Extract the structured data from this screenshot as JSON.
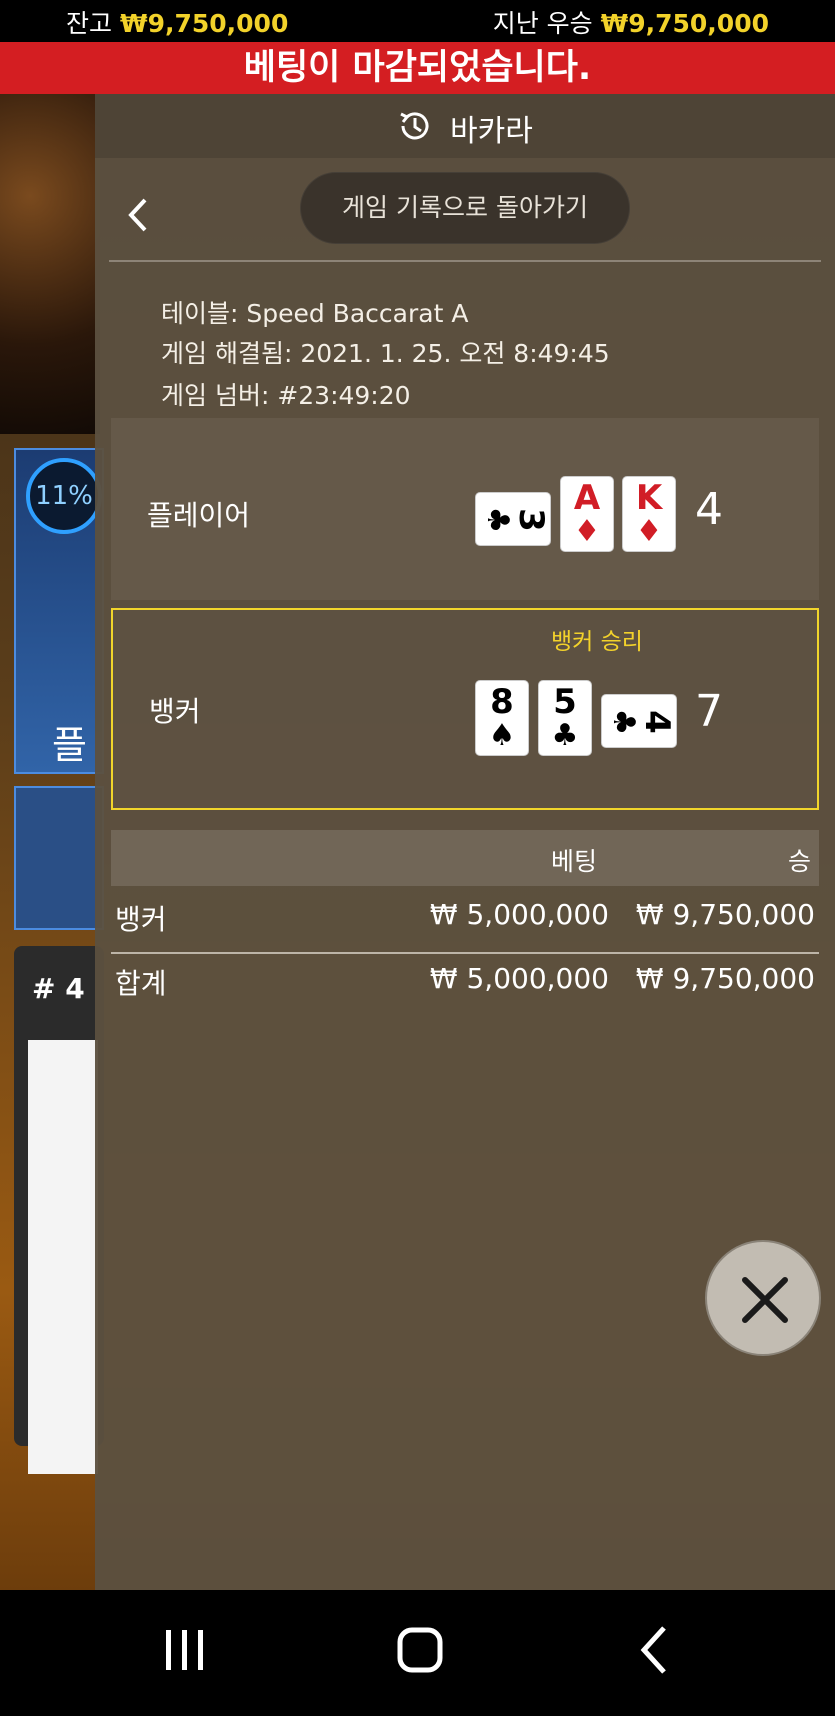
{
  "topbar": {
    "balance_label": "잔고",
    "balance_value": "₩9,750,000",
    "last_win_label": "지난 우승",
    "last_win_value": "₩9,750,000"
  },
  "banner": {
    "text": "베팅이 마감되었습니다."
  },
  "background": {
    "percent": "11%",
    "player_text": "플",
    "road_number": "# 4"
  },
  "panel": {
    "title": "바카라",
    "back_to_history": "게임 기록으로 돌아가기",
    "info": {
      "table": "테이블: Speed Baccarat A",
      "resolved": "게임 해결됨: 2021. 1. 25. 오전 8:49:45",
      "game_number": "게임 넘버: #23:49:20"
    },
    "player": {
      "label": "플레이어",
      "cards": [
        {
          "rank": "3",
          "suit": "♣",
          "color": "black",
          "orientation": "horizontal"
        },
        {
          "rank": "A",
          "suit": "♦",
          "color": "red",
          "orientation": "vertical"
        },
        {
          "rank": "K",
          "suit": "♦",
          "color": "red",
          "orientation": "vertical"
        }
      ],
      "score": "4"
    },
    "banker": {
      "label": "뱅커",
      "result": "뱅커 승리",
      "cards": [
        {
          "rank": "8",
          "suit": "♠",
          "color": "black",
          "orientation": "vertical"
        },
        {
          "rank": "5",
          "suit": "♣",
          "color": "black",
          "orientation": "vertical"
        },
        {
          "rank": "4",
          "suit": "♣",
          "color": "black",
          "orientation": "horizontal"
        }
      ],
      "score": "7"
    },
    "bets": {
      "header_bet": "베팅",
      "header_win": "승",
      "rows": [
        {
          "name": "뱅커",
          "bet": "₩ 5,000,000",
          "win": "₩ 9,750,000"
        },
        {
          "name": "합계",
          "bet": "₩ 5,000,000",
          "win": "₩ 9,750,000"
        }
      ]
    }
  },
  "colors": {
    "accent_gold": "#f2d22a",
    "banner_red": "#d41e22",
    "win_highlight": "#f1d52b"
  }
}
